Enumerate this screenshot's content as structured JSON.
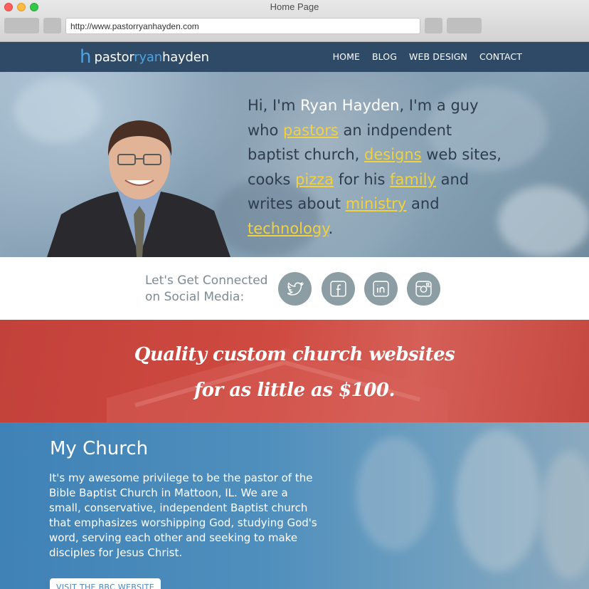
{
  "window": {
    "title": "Home Page",
    "url": "http://www.pastorryanhayden.com"
  },
  "header": {
    "logo": {
      "prefix": "pastor",
      "middle": "ryan",
      "suffix": "hayden"
    },
    "nav": [
      "HOME",
      "BLOG",
      "WEB DESIGN",
      "CONTACT"
    ]
  },
  "hero": {
    "t1": "Hi, I'm ",
    "name": "Ryan Hayden",
    "t2": ", I'm a guy who ",
    "w_pastors": "pastors",
    "t3": " an indpendent baptist church, ",
    "w_designs": "designs",
    "t4": " web sites, cooks ",
    "w_pizza": "pizza",
    "t5": " for his ",
    "w_family": "family",
    "t6": " and writes about ",
    "w_ministry": "ministry",
    "t7": " and ",
    "w_technology": "technology",
    "t8": "."
  },
  "social": {
    "line1": "Let's Get Connected",
    "line2": "on Social Media:",
    "icons": [
      "twitter-icon",
      "facebook-icon",
      "linkedin-icon",
      "instagram-icon"
    ]
  },
  "banner": {
    "line1": "Quality custom church websites",
    "line2": "for as little as $100."
  },
  "church": {
    "title": "My Church",
    "body": "It's my awesome privilege to be the pastor of the Bible Baptist Church in Mattoon, IL.  We are a small, conservative, independent Baptist church that emphasizes worshipping God, studying God's word, serving each other and seeking to make disciples for Jesus Christ.",
    "button": "VISIT THE BBC WEBSITE"
  },
  "colors": {
    "header": "#2e4a66",
    "accent_blue": "#4fa3e0",
    "highlight_yellow": "#f2d13b",
    "banner_red": "#c9463d",
    "church_blue": "#4583b7",
    "social_icon": "#8c9ea3"
  }
}
